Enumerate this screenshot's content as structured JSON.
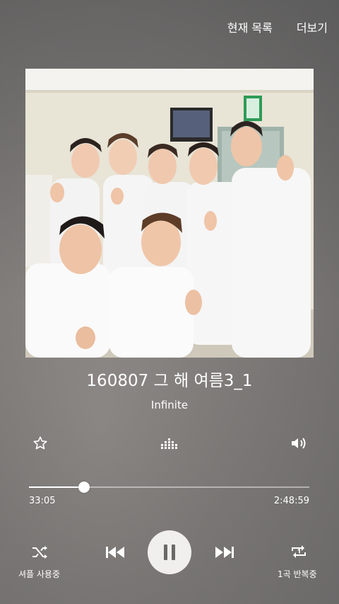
{
  "top_bar": {
    "current_list_label": "현재 목록",
    "more_label": "더보기"
  },
  "track": {
    "title": "160807 그 해 여름3_1",
    "artist": "Infinite"
  },
  "progress": {
    "elapsed": "33:05",
    "duration": "2:48:59",
    "fraction": 0.196
  },
  "controls": {
    "shuffle_label": "셔플 사용중",
    "repeat_label": "1곡 반복중"
  },
  "icons": {
    "favorite": "star-outline-icon",
    "equalizer": "equalizer-icon",
    "volume": "volume-icon",
    "shuffle": "shuffle-icon",
    "previous": "skip-previous-icon",
    "pause": "pause-icon",
    "next": "skip-next-icon",
    "repeat_one": "repeat-one-icon"
  },
  "colors": {
    "accent": "#ffffff",
    "play_button_bg": "#f1efee",
    "pause_glyph": "#6b6968"
  }
}
